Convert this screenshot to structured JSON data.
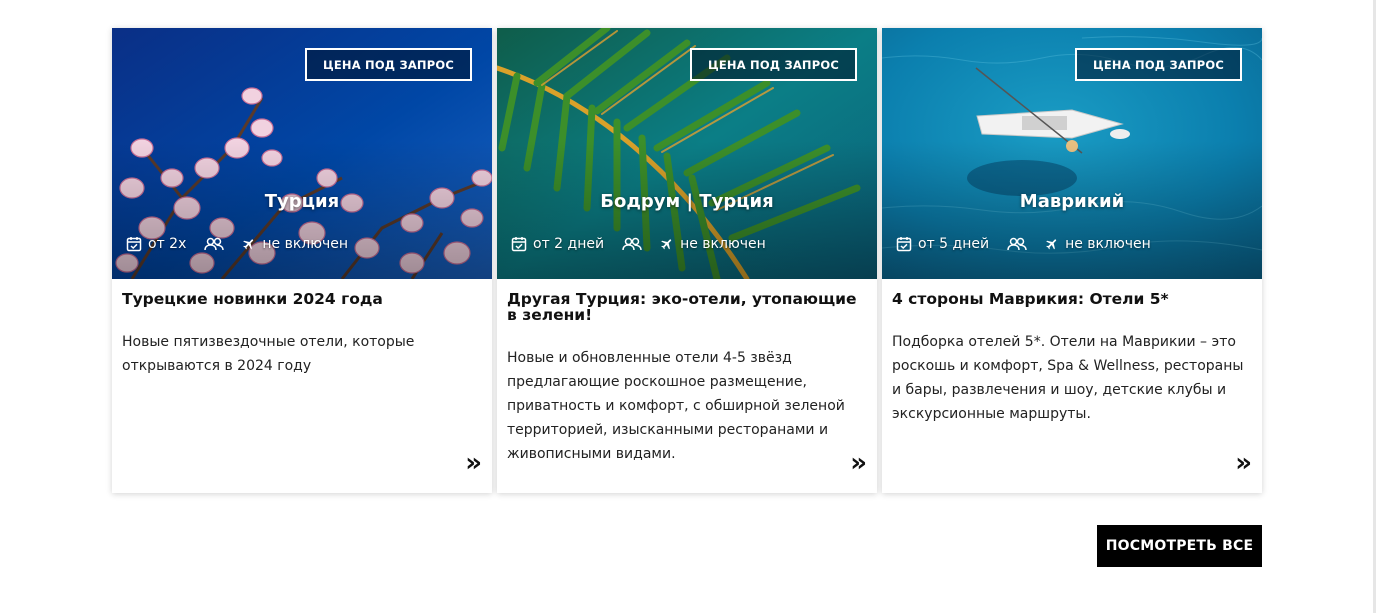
{
  "cards": [
    {
      "badge": "ЦЕНА ПОД ЗАПРОС",
      "destination": "Турция",
      "duration": "от 2х",
      "flight": "не включен",
      "title": "Турецкие новинки 2024 года",
      "description": "Новые пятизвездочные отели, которые открываются в 2024 году",
      "more": "»"
    },
    {
      "badge": "ЦЕНА ПОД ЗАПРОС",
      "destination": "Бодрум | Турция",
      "duration": "от 2 дней",
      "flight": "не включен",
      "title": "Другая Турция: эко-отели, утопающие в зелени!",
      "description": "Новые и обновленные отели 4-5 звёзд предлагающие роскошное размещение, приватность и комфорт, с обширной зеленой территорией, изысканными ресторанами и живописными видами.",
      "more": "»"
    },
    {
      "badge": "ЦЕНА ПОД ЗАПРОС",
      "destination": "Маврикий",
      "duration": "от 5 дней",
      "flight": "не включен",
      "title": "4 стороны Маврикия: Отели 5*",
      "description": "Подборка отелей 5*. Отели на Маврикии – это роскошь и комфорт, Spa & Wellness, рестораны и бары, развлечения и шоу, детские клубы и экскурсионные маршруты.",
      "more": "»"
    }
  ],
  "view_all_label": "ПОСМОТРЕТЬ ВСЕ",
  "icons": {
    "duration": "calendar-check-icon",
    "guests": "people-icon",
    "flight": "airplane-icon",
    "more": "double-chevron-right-icon"
  },
  "colors": {
    "button_bg": "#000000",
    "button_text": "#ffffff",
    "badge_border": "#ffffff",
    "text": "#111111"
  }
}
